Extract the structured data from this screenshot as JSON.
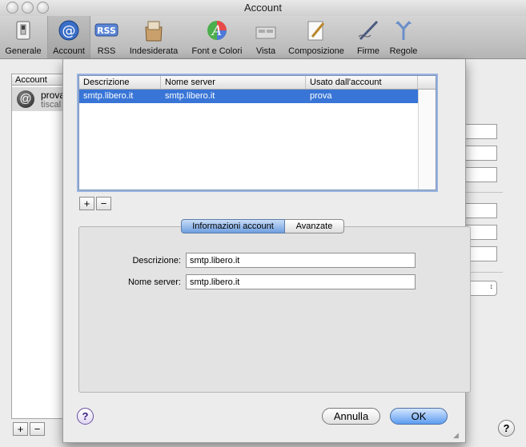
{
  "window": {
    "title": "Account"
  },
  "toolbar": {
    "items": [
      {
        "label": "Generale",
        "icon": "switch-icon"
      },
      {
        "label": "Account",
        "icon": "at-sign-icon",
        "selected": true
      },
      {
        "label": "RSS",
        "icon": "rss-icon"
      },
      {
        "label": "Indesiderata",
        "icon": "junk-mail-icon"
      },
      {
        "label": "Font e Colori",
        "icon": "font-colors-icon"
      },
      {
        "label": "Vista",
        "icon": "view-icon"
      },
      {
        "label": "Composizione",
        "icon": "compose-pencil-icon"
      },
      {
        "label": "Firme",
        "icon": "signature-pen-icon"
      },
      {
        "label": "Regole",
        "icon": "rules-arrows-icon"
      }
    ],
    "rss_badge": "RSS"
  },
  "accounts": {
    "header": "Account",
    "avatar_glyph": "@",
    "name": "prova",
    "subtitle": "tiscal"
  },
  "sheet": {
    "table": {
      "columns": [
        "Descrizione",
        "Nome server",
        "Usato dall'account"
      ],
      "rows": [
        {
          "descrizione": "smtp.libero.it",
          "server": "smtp.libero.it",
          "account": "prova"
        }
      ]
    },
    "add_label": "+",
    "remove_label": "−",
    "tabs": {
      "info": "Informazioni account",
      "advanced": "Avanzate"
    },
    "fields": {
      "descrizione_label": "Descrizione:",
      "descrizione_value": "smtp.libero.it",
      "server_label": "Nome server:",
      "server_value": "smtp.libero.it"
    },
    "cancel_label": "Annulla",
    "ok_label": "OK",
    "help_label": "?"
  },
  "footer": {
    "add_label": "+",
    "remove_label": "−",
    "help_label": "?"
  }
}
